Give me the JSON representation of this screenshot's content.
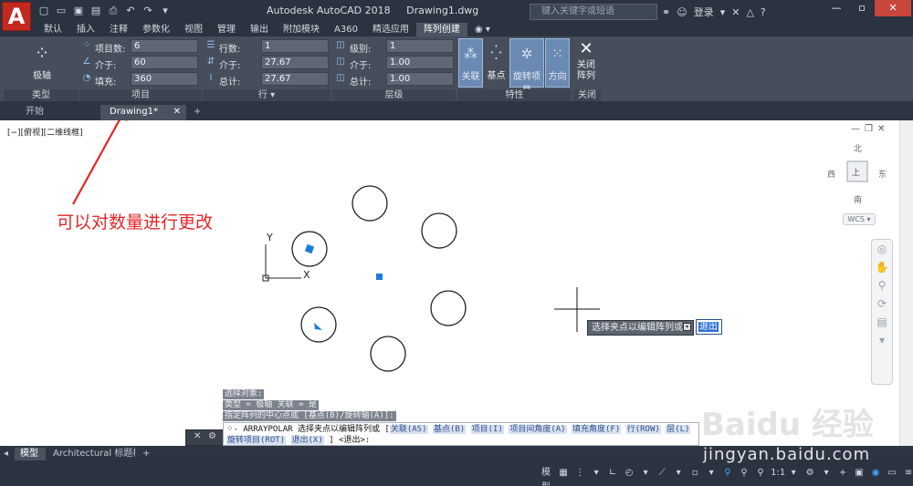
{
  "title_bar": {
    "app_name": "Autodesk AutoCAD 2018",
    "document": "Drawing1.dwg",
    "search_placeholder": "键入关键字或短语",
    "login_label": "登录",
    "help_label": "?"
  },
  "ribbon_tabs": [
    "默认",
    "插入",
    "注释",
    "参数化",
    "视图",
    "管理",
    "输出",
    "附加模块",
    "A360",
    "精选应用",
    "阵列创建"
  ],
  "active_tab": "阵列创建",
  "ribbon": {
    "type_panel": {
      "button_label": "极轴",
      "title": "类型"
    },
    "items_panel": {
      "title": "项目",
      "rows": [
        {
          "label": "项目数:",
          "value": "6"
        },
        {
          "label": "介于:",
          "value": "60"
        },
        {
          "label": "填充:",
          "value": "360"
        }
      ]
    },
    "rows_panel": {
      "title": "行 ▾",
      "rows": [
        {
          "label": "行数:",
          "value": "1"
        },
        {
          "label": "介于:",
          "value": "27.67"
        },
        {
          "label": "总计:",
          "value": "27.67"
        }
      ]
    },
    "levels_panel": {
      "title": "层级",
      "rows": [
        {
          "label": "级别:",
          "value": "1"
        },
        {
          "label": "介于:",
          "value": "1.00"
        },
        {
          "label": "总计:",
          "value": "1.00"
        }
      ]
    },
    "properties_panel": {
      "title": "特性",
      "buttons": [
        "关联",
        "基点",
        "旋转项目",
        "方向"
      ]
    },
    "close_panel": {
      "title": "关闭",
      "button_label": "关闭\n阵列"
    }
  },
  "doc_tabs": {
    "start": "开始",
    "drawing": "Drawing1*",
    "add": "+"
  },
  "viewport": {
    "label": "[−][俯视][二维线框]",
    "viewcube": {
      "north": "北",
      "south": "南",
      "east": "东",
      "west": "西",
      "face": "上"
    },
    "wcs": "WCS ▾",
    "ucs_x": "X",
    "ucs_y": "Y"
  },
  "annotation": "可以对数量进行更改",
  "tooltip": {
    "text": "选择夹点以编辑阵列或",
    "input_value": "退出"
  },
  "command": {
    "history": [
      "选择对象:",
      "类型 = 极轴  关联 = 是",
      "指定阵列的中心点或 [基点(B)/旋转轴(A)]:"
    ],
    "line1_prefix": "- ARRAYPOLAR 选择夹点以编辑阵列或 [",
    "options": [
      "关联(AS)",
      "基点(B)",
      "项目(I)",
      "项目间角度(A)",
      "填充角度(F)",
      "行(ROW)",
      "层(L)",
      "旋转项目(ROT)",
      "退出(X)"
    ],
    "line2_suffix": "] <退出>:"
  },
  "layout_tabs": [
    "模型",
    "Architectural 标题栏",
    "+"
  ],
  "statusbar": {
    "model_label": "模型",
    "scale": "1:1"
  },
  "watermark": {
    "brand": "Baidu 经验",
    "url": "jingyan.baidu.com"
  }
}
